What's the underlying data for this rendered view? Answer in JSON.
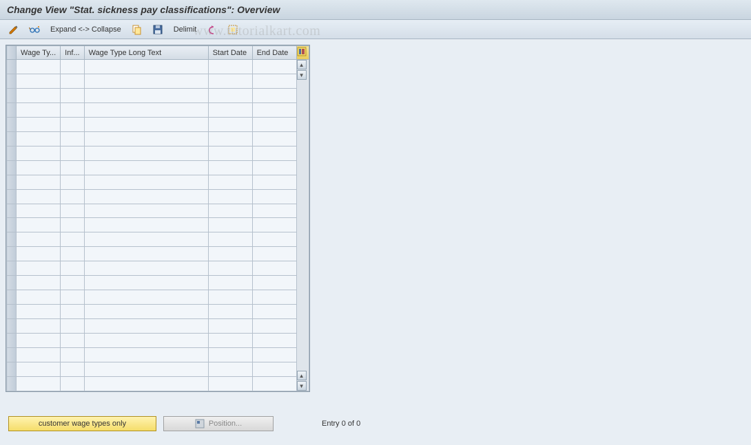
{
  "title": "Change View \"Stat. sickness pay classifications\": Overview",
  "toolbar": {
    "expand_collapse": "Expand <-> Collapse",
    "delimit": "Delimit"
  },
  "table": {
    "row_count": 23,
    "headers": {
      "wage_type": "Wage Ty...",
      "inf": "Inf...",
      "long_text": "Wage Type Long Text",
      "start_date": "Start Date",
      "end_date": "End Date"
    }
  },
  "footer": {
    "customer_btn": "customer wage types only",
    "position_btn": "Position...",
    "entry_text": "Entry 0 of 0"
  },
  "watermark": "www.tutorialkart.com"
}
